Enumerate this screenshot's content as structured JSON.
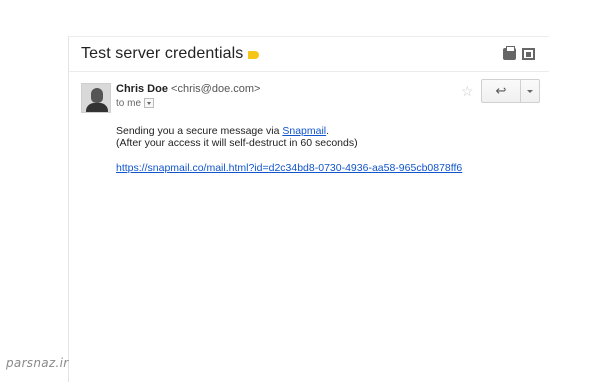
{
  "email": {
    "subject": "Test server credentials",
    "label_color": "#f5c518",
    "sender_name": "Chris Doe",
    "sender_email": "<chris@doe.com>",
    "to_text": "to me",
    "body_line1_prefix": "Sending you a secure message via ",
    "body_line1_link": "Snapmail",
    "body_line1_suffix": ".",
    "body_line2": "(After your access it will self-destruct in 60 seconds)",
    "secure_link": "https://snapmail.co/mail.html?id=d2c34bd8-0730-4936-aa58-965cb0878ff6"
  },
  "icons": {
    "print": "print-icon",
    "new_window": "new-window-icon",
    "star": "star-icon",
    "reply": "reply-icon",
    "more": "chevron-down-icon"
  },
  "watermark": "parsnaz.ir"
}
